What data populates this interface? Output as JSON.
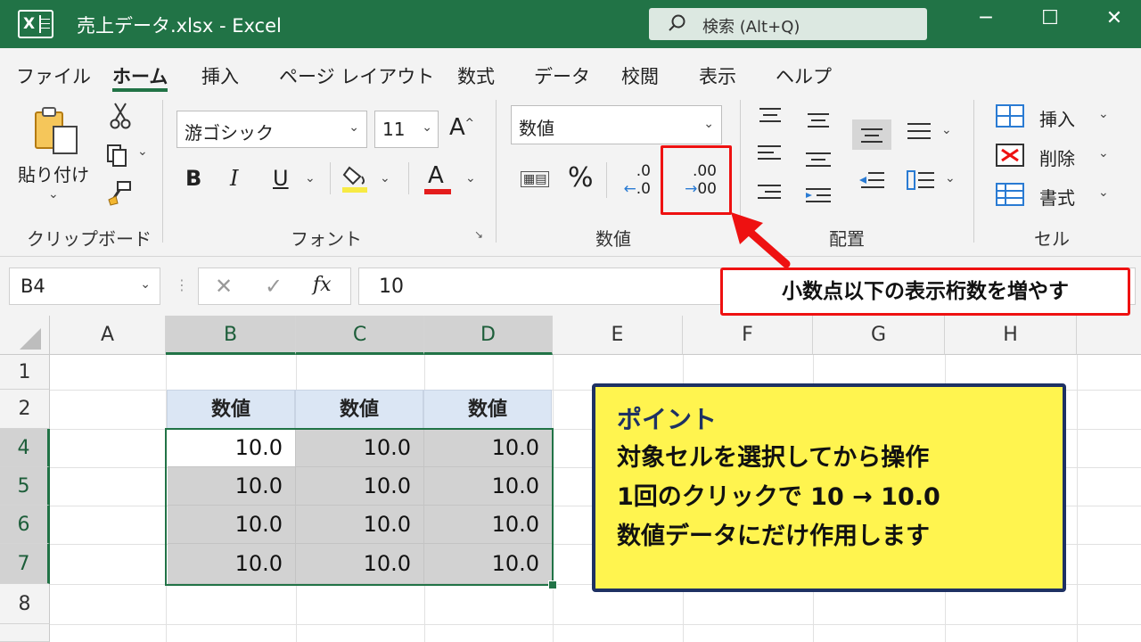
{
  "titlebar": {
    "logo": "X",
    "title": "売上データ.xlsx  -  Excel",
    "search_placeholder": "検索 (Alt+Q)",
    "minimize": "─",
    "maximize": "☐",
    "close": "✕"
  },
  "tabs": [
    "ファイル",
    "ホーム",
    "挿入",
    "ページ レイアウト",
    "数式",
    "データ",
    "校閲",
    "表示",
    "ヘルプ"
  ],
  "ribbon": {
    "clipboard": {
      "paste": "貼り付け",
      "label": "クリップボード"
    },
    "font": {
      "font_name": "游ゴシック",
      "font_size": "11",
      "bold": "B",
      "italic": "I",
      "underline": "U",
      "font_color": "A",
      "grow": "A",
      "label": "フォント"
    },
    "number": {
      "format": "数値",
      "percent": "%",
      "dec_top": ".0",
      "dec_bot": ".0",
      "inc_top": ".00",
      "inc_bot": "00",
      "label": "数値"
    },
    "alignment": {
      "label": "配置"
    },
    "cells": {
      "insert": "挿入",
      "delete": "削除",
      "format": "書式",
      "label": "セル"
    }
  },
  "formula_bar": {
    "name_box": "B4",
    "fx": "fx",
    "value": "10"
  },
  "grid": {
    "columns": [
      "A",
      "B",
      "C",
      "D",
      "E",
      "F",
      "G",
      "H"
    ],
    "rows": [
      "1",
      "2",
      "4",
      "5",
      "6",
      "7",
      "8"
    ],
    "header_row": [
      "数値",
      "数値",
      "数値"
    ],
    "values": [
      [
        "10.0",
        "10.0",
        "10.0"
      ],
      [
        "10.0",
        "10.0",
        "10.0"
      ],
      [
        "10.0",
        "10.0",
        "10.0"
      ],
      [
        "10.0",
        "10.0",
        "10.0"
      ]
    ]
  },
  "annotations": {
    "callout": "小数点以下の表示桁数を増やす",
    "point_title": "ポイント",
    "point_lines": [
      "対象セルを選択してから操作",
      "1回のクリックで 10 → 10.0",
      "数値データにだけ作用します"
    ]
  },
  "colors": {
    "excel_green": "#217346",
    "highlight_red": "#ee1111",
    "note_yellow": "#fff44f",
    "note_border": "#1e3163"
  }
}
